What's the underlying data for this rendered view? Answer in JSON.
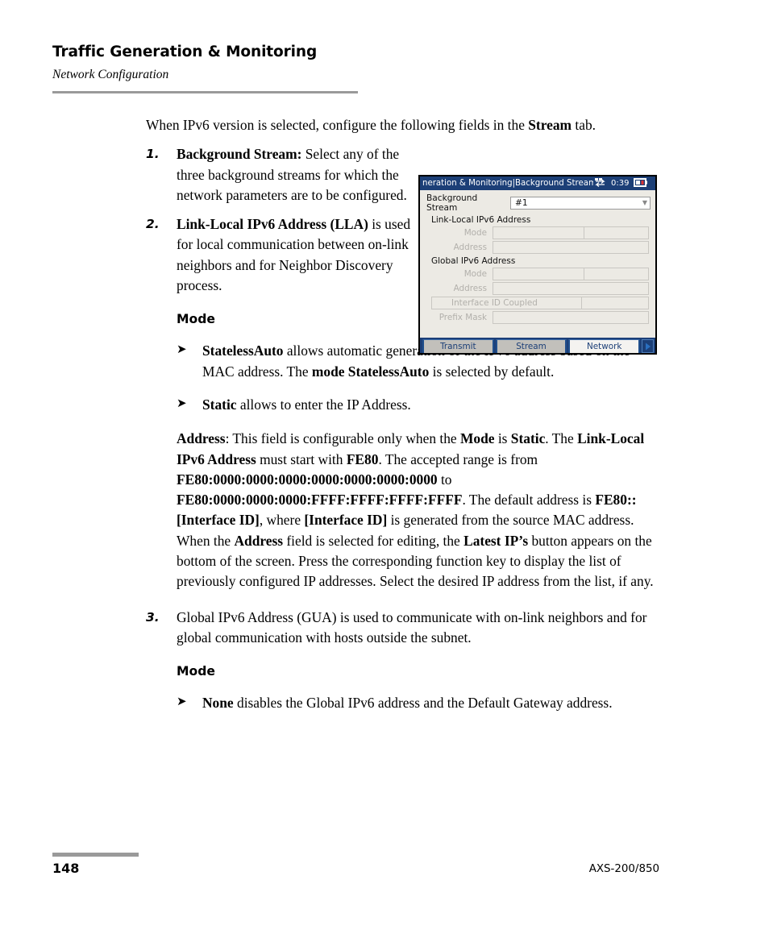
{
  "header": {
    "chapter_title": "Traffic Generation & Monitoring",
    "section_subtitle": "Network Configuration"
  },
  "intro": {
    "text_before": "When IPv6 version is selected, configure the following fields in the ",
    "bold_term": "Stream",
    "text_after": " tab."
  },
  "items": [
    {
      "marker": "1.",
      "bold_lead": "Background Stream:",
      "text": " Select any of the three background streams for which the network parameters are to be configured."
    },
    {
      "marker": "2.",
      "bold_lead": "Link-Local IPv6 Address (LLA)",
      "text": " is used for local communication between on-link neighbors and for Neighbor Discovery process."
    },
    {
      "marker": "3.",
      "bold_lead": "",
      "text": "Global IPv6 Address (GUA) is used to communicate with on-link neighbors and for global communication with hosts outside the subnet."
    }
  ],
  "mode_heading_1": "Mode",
  "mode_heading_2": "Mode",
  "bullets": [
    {
      "arrow": "➤",
      "bold_lead": "StatelessAuto",
      "mid_text": " allows automatic generation of the IPv6 address based on the MAC address. The ",
      "bold_mid": "mode StatelessAuto",
      "end_text": " is selected by default."
    },
    {
      "arrow": "➤",
      "bold_lead": "Static",
      "mid_text": " allows to enter the IP Address.",
      "bold_mid": "",
      "end_text": ""
    },
    {
      "arrow": "➤",
      "bold_lead": "None",
      "mid_text": " disables the Global IPv6 address and the Default Gateway address.",
      "bold_mid": "",
      "end_text": ""
    }
  ],
  "address_para": {
    "b1": "Address",
    "t1": ": This field is configurable only when the ",
    "b2": "Mode",
    "t2": " is ",
    "b3": "Static",
    "t3": ". The ",
    "b4": "Link-Local IPv6 Address",
    "t4": " must start with ",
    "b5": "FE80",
    "t5": ". The accepted range is from ",
    "b6": "FE80:0000:0000:0000:0000:0000:0000:0000",
    "t6": " to ",
    "b7": "FE80:0000:0000:0000:FFFF:FFFF:FFFF:FFFF",
    "t7": ". The default address is ",
    "b8": "FE80::[Interface ID]",
    "t8": ", where ",
    "b9": "[Interface ID]",
    "t9": " is generated from the source MAC address. When the ",
    "b10": "Address",
    "t10": " field is selected for editing, the ",
    "b11": "Latest IP’s",
    "t11": " button appears on the bottom of the screen. Press the corresponding function key to display the list of previously configured IP addresses. Select the desired IP address from the list, if any."
  },
  "device": {
    "titlebar": {
      "title": "neration & Monitoring|Background Streams Config",
      "network_icon": "network-traffic-icon",
      "clock": "0:39",
      "battery_icon": "battery-icon"
    },
    "stream_row": {
      "label": "Background Stream",
      "value": "#1",
      "caret_icon": "chevron-down-icon"
    },
    "groups": [
      {
        "title": "Link-Local IPv6 Address",
        "fields": [
          {
            "label": "Mode",
            "type": "split",
            "value": ""
          },
          {
            "label": "Address",
            "type": "full",
            "value": ""
          }
        ]
      },
      {
        "title": "Global IPv6 Address",
        "fields": [
          {
            "label": "Mode",
            "type": "split",
            "value": ""
          },
          {
            "label": "Address",
            "type": "full",
            "value": ""
          },
          {
            "label": "Interface ID Coupled",
            "type": "coupled",
            "value": ""
          },
          {
            "label": "Prefix Mask",
            "type": "full",
            "value": ""
          }
        ]
      }
    ],
    "tabs": [
      {
        "label": "Transmit",
        "active": false
      },
      {
        "label": "Stream",
        "active": false
      },
      {
        "label": "Network",
        "active": true
      }
    ],
    "tab_scroll_icon": "chevron-right-icon",
    "colors": {
      "titlebar": "#1c3f77",
      "screen_bg": "#eceae4",
      "tab_inactive": "#c2c0bb",
      "tab_active": "#f4f3f0",
      "tab_text": "#1c3f77",
      "disabled_label": "#b2b0ab"
    }
  },
  "footer": {
    "page_number": "148",
    "product": "AXS-200/850"
  }
}
